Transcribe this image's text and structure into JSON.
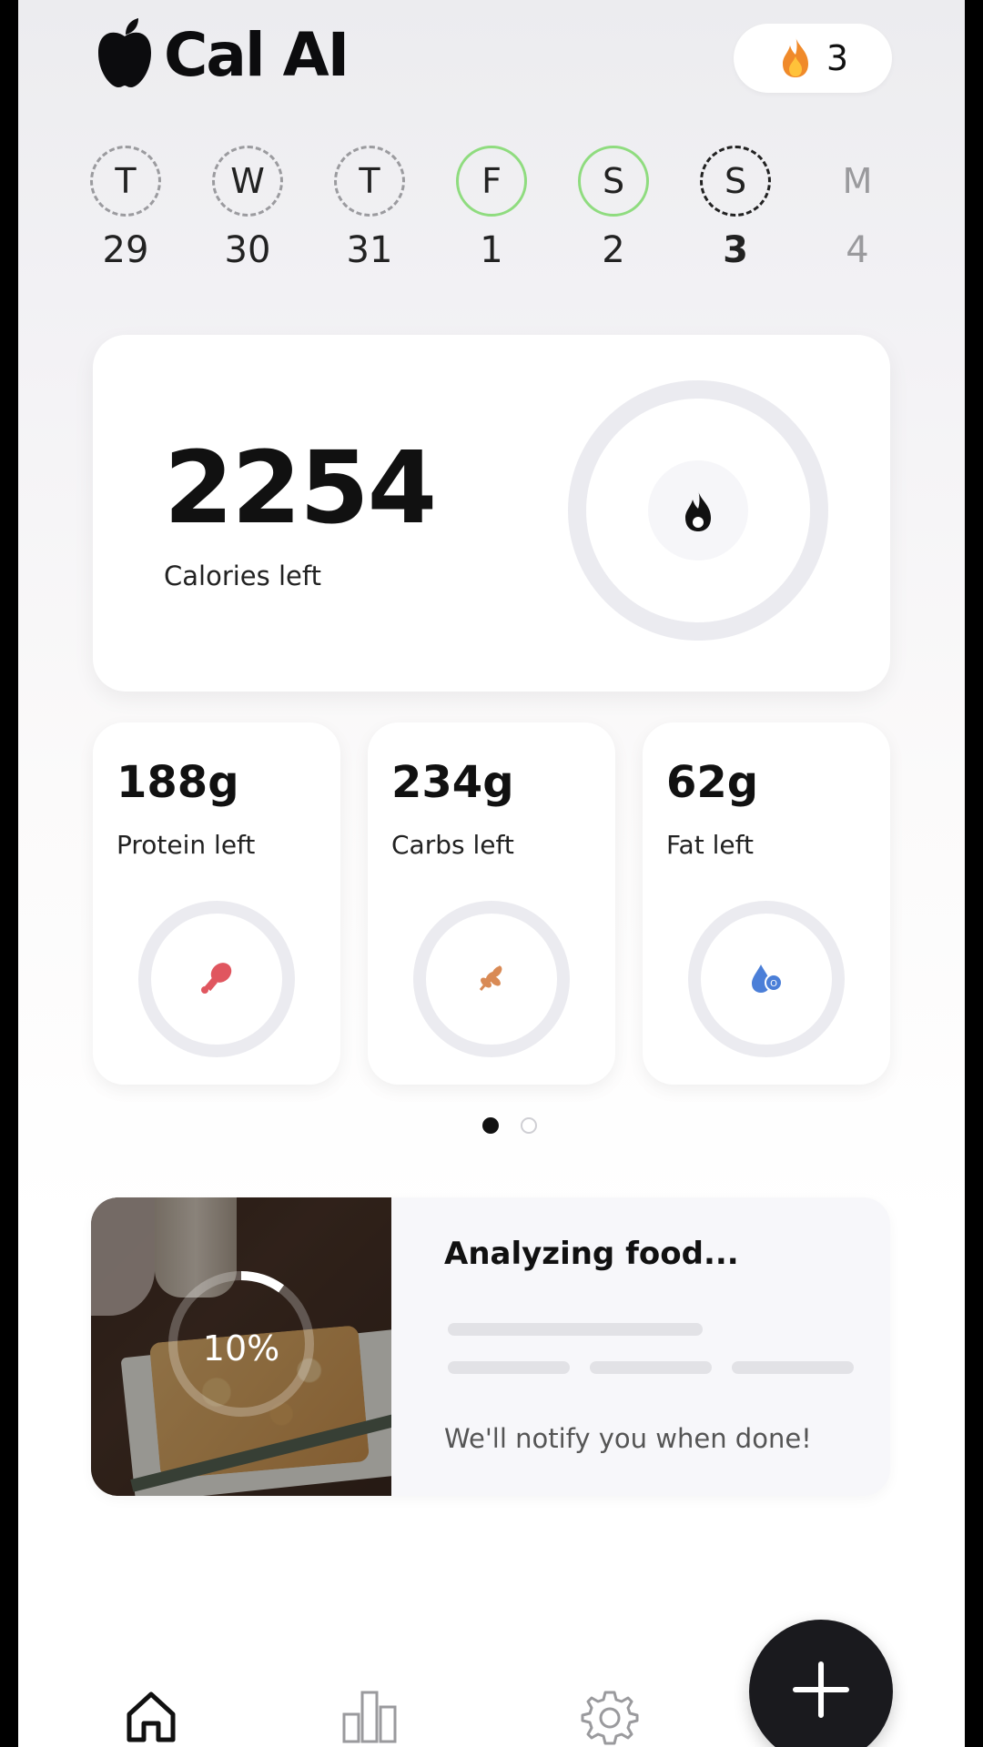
{
  "header": {
    "app_title": "Cal AI",
    "logo_icon": "apple-icon",
    "streak_icon": "flame-icon",
    "streak_count": "3"
  },
  "week": {
    "days": [
      {
        "letter": "T",
        "date": "29",
        "state": "dashed"
      },
      {
        "letter": "W",
        "date": "30",
        "state": "dashed"
      },
      {
        "letter": "T",
        "date": "31",
        "state": "dashed"
      },
      {
        "letter": "F",
        "date": "1",
        "state": "complete"
      },
      {
        "letter": "S",
        "date": "2",
        "state": "complete"
      },
      {
        "letter": "S",
        "date": "3",
        "state": "today"
      },
      {
        "letter": "M",
        "date": "4",
        "state": "future"
      }
    ]
  },
  "calories": {
    "value": "2254",
    "label": "Calories left",
    "icon": "flame-icon"
  },
  "macros": [
    {
      "value": "188g",
      "label": "Protein left",
      "icon": "drumstick-icon",
      "color": "#e0565f"
    },
    {
      "value": "234g",
      "label": "Carbs left",
      "icon": "wheat-icon",
      "color": "#d98a55"
    },
    {
      "value": "62g",
      "label": "Fat left",
      "icon": "oil-drop-icon",
      "color": "#4b7fd8"
    }
  ],
  "pager": {
    "active": 0,
    "total": 2
  },
  "analyzing": {
    "title": "Analyzing food...",
    "progress_text": "10%",
    "progress": 0.1,
    "note": "We'll notify you when done!"
  },
  "nav": {
    "items": [
      "home-icon",
      "bar-chart-icon",
      "gear-icon"
    ],
    "fab_icon": "plus-icon"
  },
  "colors": {
    "accent_green": "#8fdc7f",
    "dark": "#1a1a1e",
    "ring": "#ebebf0"
  }
}
